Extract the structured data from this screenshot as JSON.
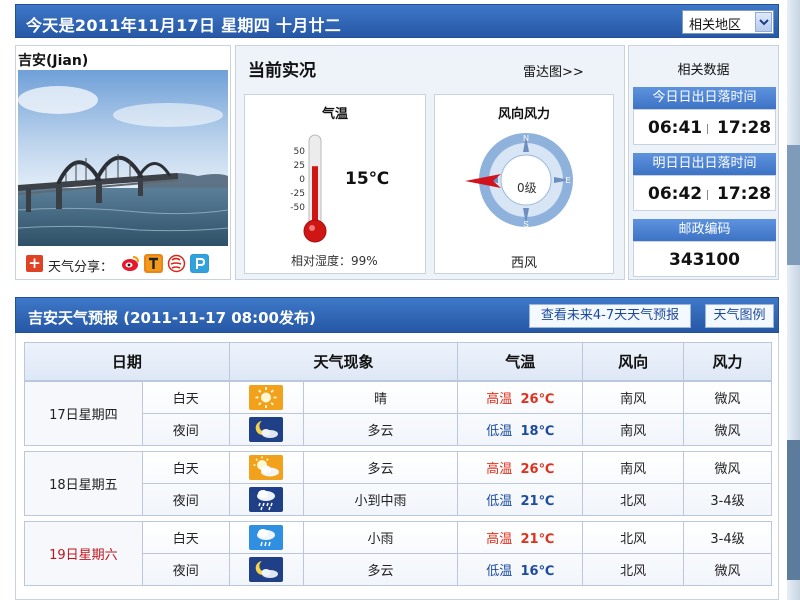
{
  "header": {
    "date_text": "今天是2011年11月17日  星期四  十月廿二",
    "region_label": "相关地区"
  },
  "city": {
    "name": "吉安(Jian)",
    "share_label": "天气分享："
  },
  "current": {
    "title": "当前实况",
    "radar_link": "雷达图>>",
    "temp_label": "气温",
    "temp_ticks": [
      "50",
      "25",
      "0",
      "-25",
      "-50"
    ],
    "temperature": "15℃",
    "temperature_value": 15,
    "humidity": "相对湿度：99%",
    "wind_label": "风向风力",
    "wind_level": "0级",
    "wind_direction": "西风",
    "compass": {
      "n": "N",
      "s": "S",
      "e": "E"
    }
  },
  "related": {
    "title": "相关数据",
    "today_label": "今日日出日落时间",
    "today_sunrise": "06:41",
    "today_sunset": "17:28",
    "tomorrow_label": "明日日出日落时间",
    "tomorrow_sunrise": "06:42",
    "tomorrow_sunset": "17:28",
    "postal_label": "邮政编码",
    "postal_code": "343100"
  },
  "forecast": {
    "title": "吉安天气预报  (2011-11-17  08:00发布)",
    "btn_more": "查看未来4-7天天气预报",
    "btn_legend": "天气图例",
    "columns": [
      "日期",
      "天气现象",
      "气温",
      "风向",
      "风力"
    ],
    "days": [
      {
        "date": "17日星期四",
        "rows": [
          {
            "period": "白天",
            "icon": "sunny-icon",
            "weather": "晴",
            "temp_label": "高温",
            "temp": "26℃",
            "wind_dir": "南风",
            "wind_force": "微风"
          },
          {
            "period": "夜间",
            "icon": "partly-cloudy-night-icon",
            "weather": "多云",
            "temp_label": "低温",
            "temp": "18℃",
            "wind_dir": "南风",
            "wind_force": "微风"
          }
        ]
      },
      {
        "date": "18日星期五",
        "rows": [
          {
            "period": "白天",
            "icon": "partly-cloudy-day-icon",
            "weather": "多云",
            "temp_label": "高温",
            "temp": "26℃",
            "wind_dir": "南风",
            "wind_force": "微风"
          },
          {
            "period": "夜间",
            "icon": "moderate-rain-icon",
            "weather": "小到中雨",
            "temp_label": "低温",
            "temp": "21℃",
            "wind_dir": "北风",
            "wind_force": "3-4级"
          }
        ]
      },
      {
        "date": "19日星期六",
        "rows": [
          {
            "period": "白天",
            "icon": "light-rain-icon",
            "weather": "小雨",
            "temp_label": "高温",
            "temp": "21℃",
            "wind_dir": "北风",
            "wind_force": "3-4级"
          },
          {
            "period": "夜间",
            "icon": "partly-cloudy-night-icon",
            "weather": "多云",
            "temp_label": "低温",
            "temp": "16℃",
            "wind_dir": "北风",
            "wind_force": "微风"
          }
        ]
      }
    ]
  },
  "colors": {
    "header_blue": "#2e64b3",
    "hot_red": "#e0311e",
    "cold_blue": "#1d4c9e",
    "weekend_red": "#c0151b"
  }
}
